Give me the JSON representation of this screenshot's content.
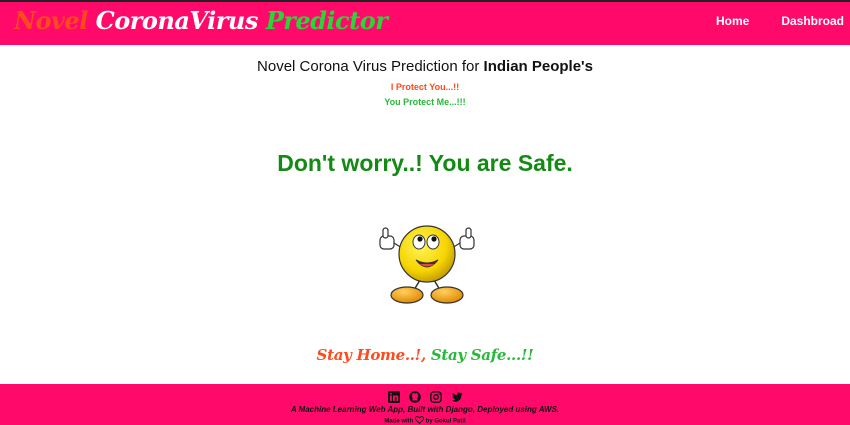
{
  "header": {
    "brand_word1": "Novel",
    "brand_word2": "CoronaVirus",
    "brand_word3": "Predictor",
    "nav": {
      "home": "Home",
      "dashboard": "Dashbroad"
    }
  },
  "main": {
    "heading_prefix": "Novel Corona Virus Prediction for ",
    "heading_bold": "Indian People's",
    "tagline1": "I Protect You...!!",
    "tagline2": "You Protect Me...!!!",
    "result": "Don't worry..! You are Safe.",
    "slogan_part1": "Stay Home..!,",
    "slogan_part2": "Stay Safe...!!"
  },
  "footer": {
    "social_icons": [
      "linkedin-icon",
      "github-icon",
      "instagram-icon",
      "twitter-icon"
    ],
    "line1": "A Machine Learning Web App, Built with Django, Deployed using AWS.",
    "made_with": "Made with",
    "by": "by Gokul Patil"
  },
  "colors": {
    "brand_pink": "#ff0a6a",
    "orange": "#ff4a1c",
    "green": "#28b83a",
    "result_green": "#138a13"
  }
}
